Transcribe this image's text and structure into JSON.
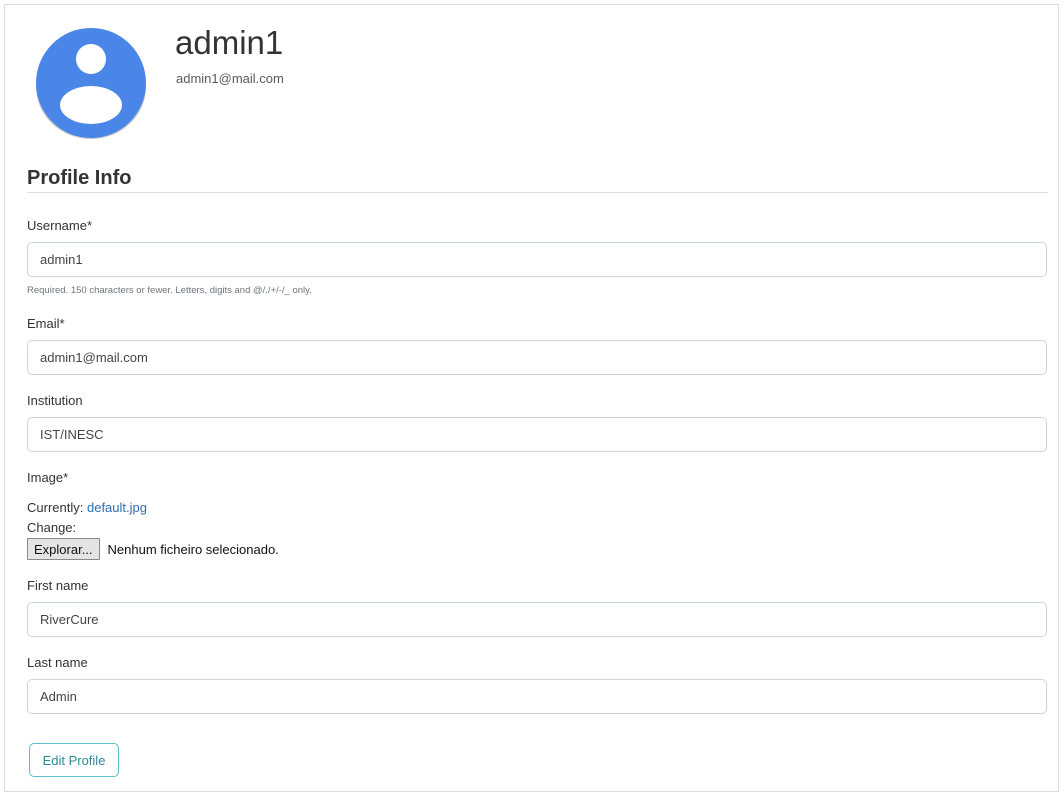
{
  "header": {
    "username": "admin1",
    "email": "admin1@mail.com",
    "avatar_icon": "user-avatar-icon",
    "avatar_color": "#4a86e8"
  },
  "section": {
    "title": "Profile Info"
  },
  "form": {
    "username": {
      "label": "Username*",
      "value": "admin1",
      "help": "Required. 150 characters or fewer. Letters, digits and @/./+/-/_ only."
    },
    "email": {
      "label": "Email*",
      "value": "admin1@mail.com"
    },
    "institution": {
      "label": "Institution",
      "value": "IST/INESC"
    },
    "image": {
      "label": "Image*",
      "currently_label": "Currently:",
      "current_file": "default.jpg",
      "change_label": "Change:",
      "browse_button": "Explorar...",
      "file_status": "Nenhum ficheiro selecionado."
    },
    "first_name": {
      "label": "First name",
      "value": "RiverCure"
    },
    "last_name": {
      "label": "Last name",
      "value": "Admin"
    }
  },
  "actions": {
    "edit_profile": "Edit Profile"
  },
  "colors": {
    "link": "#2f6db5",
    "edit_button_border": "#5fbfc7",
    "edit_button_text": "#2c8a96"
  }
}
